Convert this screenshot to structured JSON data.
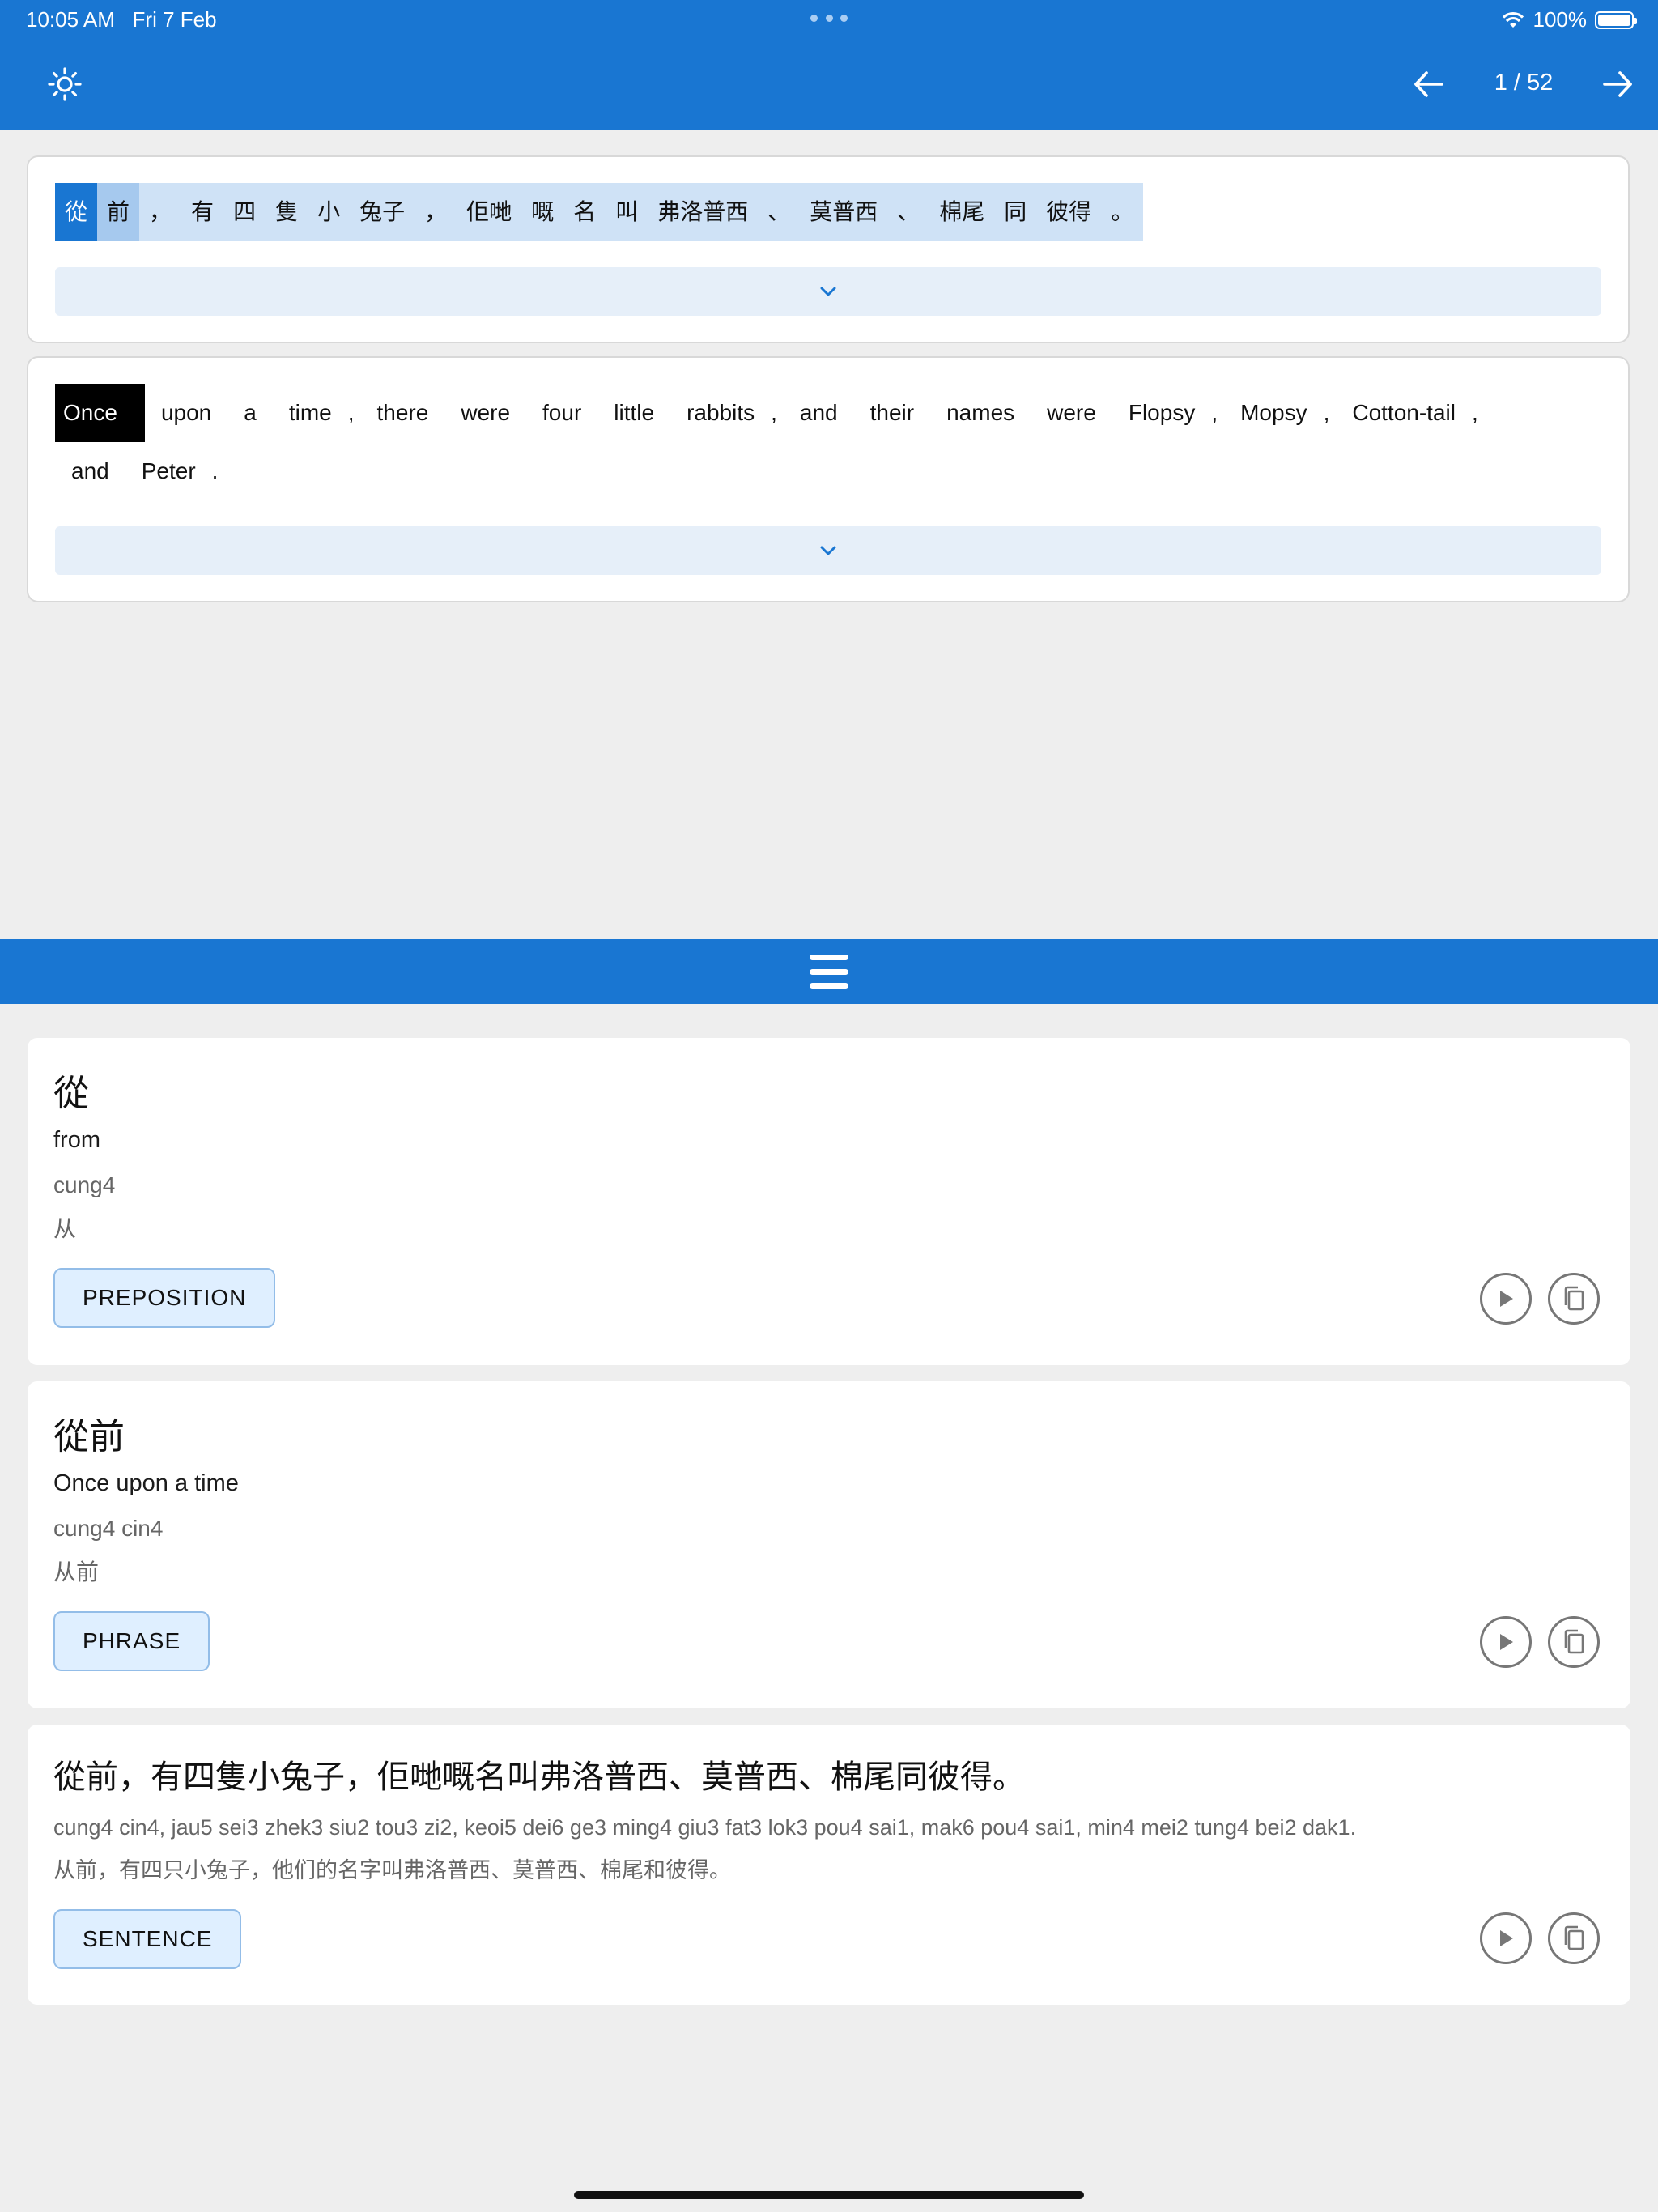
{
  "status_bar": {
    "time": "10:05 AM",
    "date": "Fri 7 Feb",
    "battery": "100%",
    "battery_level": 1.0
  },
  "header": {
    "page_indicator": "1 / 52"
  },
  "colors": {
    "primary": "#1976d2",
    "highlight_active": "#1976d2",
    "highlight_group": "#a6c9ee",
    "highlight_line": "#cfe2f6",
    "tag_bg": "#dfefff"
  },
  "source_sentence": {
    "tokens": [
      "從",
      "前",
      "，",
      "有",
      "四",
      "隻",
      "小",
      "兔子",
      "，",
      "佢哋",
      "嘅",
      "名",
      "叫",
      "弗洛普西",
      "、",
      "莫普西",
      "、",
      "棉尾",
      "同",
      "彼得",
      "。"
    ]
  },
  "translation": {
    "line1": [
      "Once",
      "upon",
      "a",
      "time",
      ",",
      "there",
      "were",
      "four",
      "little",
      "rabbits",
      ",",
      "and",
      "their",
      "names",
      "were",
      "Flopsy",
      ",",
      "Mopsy",
      ",",
      "Cotton-tail",
      ","
    ],
    "line2": [
      "and",
      "Peter",
      "."
    ]
  },
  "dictionary": [
    {
      "headword": "從",
      "meaning": "from",
      "jyutping": "cung4",
      "simplified": "从",
      "tag": "PREPOSITION"
    },
    {
      "headword": "從前",
      "meaning": "Once upon a time",
      "jyutping": "cung4 cin4",
      "simplified": "从前",
      "tag": "PHRASE"
    },
    {
      "headword": "從前，有四隻小兔子，佢哋嘅名叫弗洛普西、莫普西、棉尾同彼得。",
      "jyutping": "cung4 cin4, jau5 sei3 zhek3 siu2 tou3 zi2, keoi5 dei6 ge3 ming4 giu3 fat3 lok3 pou4 sai1, mak6 pou4 sai1, min4 mei2 tung4 bei2 dak1.",
      "simplified": "从前，有四只小兔子，他们的名字叫弗洛普西、莫普西、棉尾和彼得。",
      "tag": "SENTENCE"
    }
  ],
  "icons": {
    "theme": "sun-icon",
    "prev": "arrow-left-icon",
    "next": "arrow-right-icon",
    "expand": "chevron-down-icon",
    "play": "play-icon",
    "copy": "copy-icon",
    "divider": "drag-handle-icon"
  }
}
